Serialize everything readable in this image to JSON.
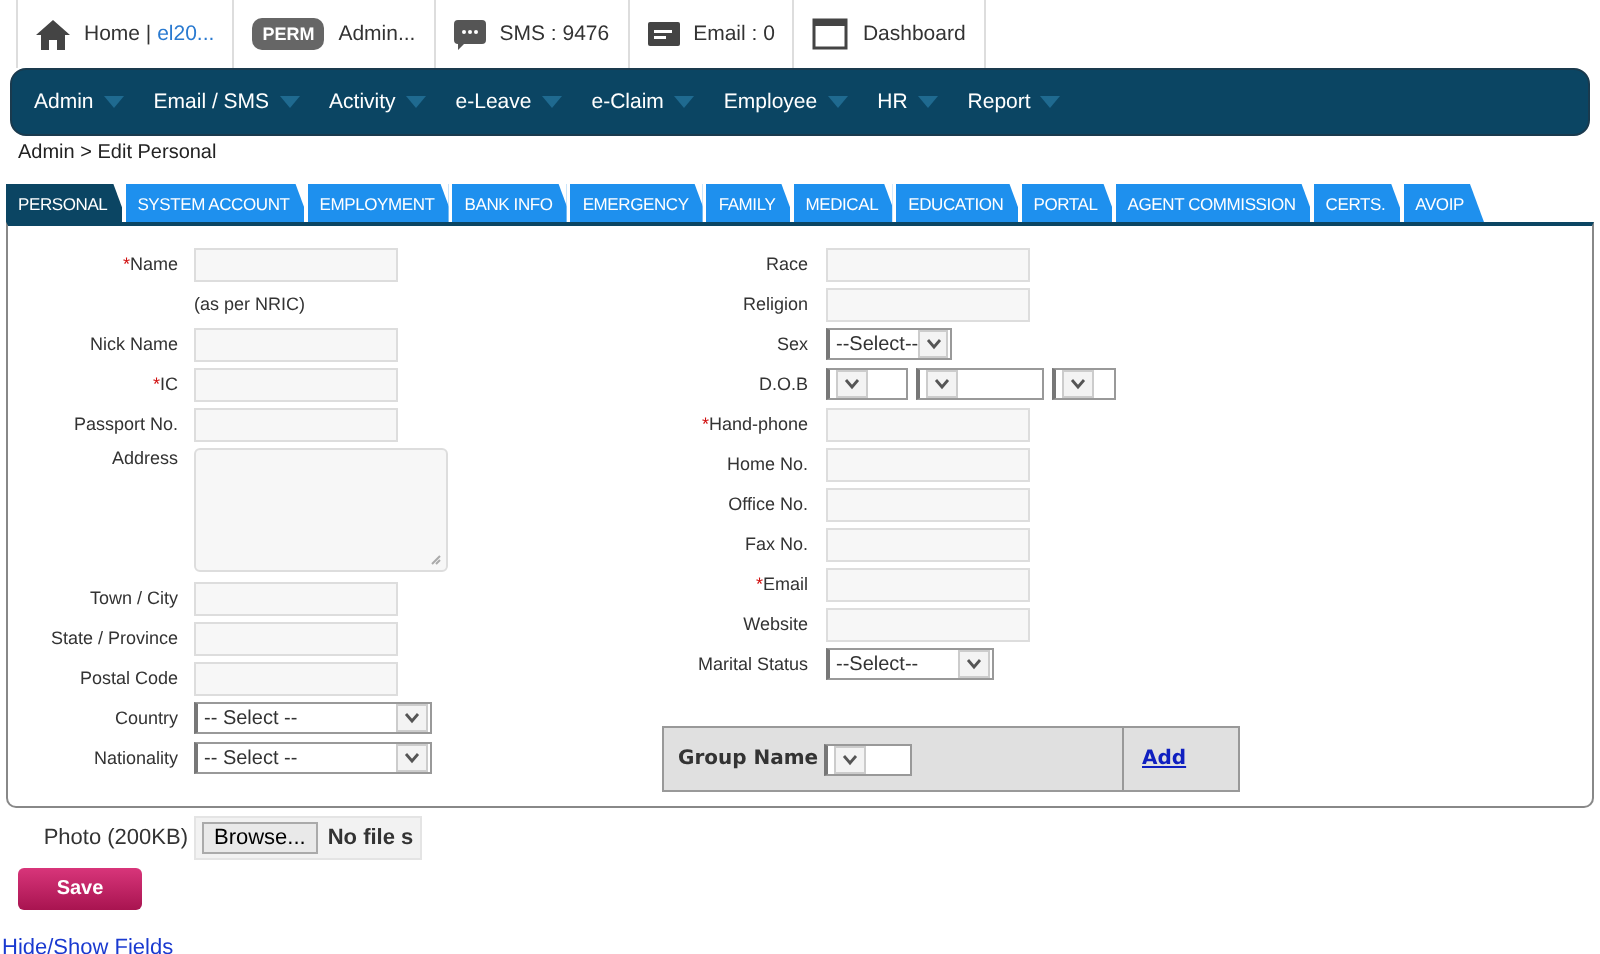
{
  "topbar": [
    {
      "kind": "home",
      "text": "Home | ",
      "link": "el20..."
    },
    {
      "kind": "perm",
      "badge": "PERM",
      "text": "Admin..."
    },
    {
      "kind": "sms",
      "text": "SMS : 9476"
    },
    {
      "kind": "email",
      "text": "Email : 0"
    },
    {
      "kind": "dashboard",
      "text": "Dashboard"
    }
  ],
  "nav": [
    "Admin",
    "Email / SMS",
    "Activity",
    "e-Leave",
    "e-Claim",
    "Employee",
    "HR",
    "Report"
  ],
  "breadcrumb": "Admin > Edit Personal",
  "tabs": [
    {
      "label": "PERSONAL",
      "selected": true
    },
    {
      "label": "SYSTEM ACCOUNT",
      "selected": false
    },
    {
      "label": "EMPLOYMENT",
      "selected": false
    },
    {
      "label": "BANK INFO",
      "selected": false
    },
    {
      "label": "EMERGENCY",
      "selected": false
    },
    {
      "label": "FAMILY",
      "selected": false
    },
    {
      "label": "MEDICAL",
      "selected": false
    },
    {
      "label": "EDUCATION",
      "selected": false
    },
    {
      "label": "PORTAL",
      "selected": false
    },
    {
      "label": "AGENT COMMISSION",
      "selected": false
    },
    {
      "label": "CERTS.",
      "selected": false
    },
    {
      "label": "AVOIP",
      "selected": false
    }
  ],
  "left_fields": [
    {
      "kind": "text",
      "label": "Name",
      "required_mark": "*"
    },
    {
      "kind": "note",
      "text": "(as per NRIC)"
    },
    {
      "kind": "text",
      "label": "Nick Name"
    },
    {
      "kind": "text",
      "label": "IC",
      "required_mark": "*"
    },
    {
      "kind": "text",
      "label": "Passport No."
    },
    {
      "kind": "textarea",
      "label": "Address"
    },
    {
      "kind": "text",
      "label": "Town / City"
    },
    {
      "kind": "text",
      "label": "State / Province"
    },
    {
      "kind": "text",
      "label": "Postal Code"
    },
    {
      "kind": "select",
      "label": "Country",
      "value": "-- Select --"
    },
    {
      "kind": "select",
      "label": "Nationality",
      "value": "-- Select --"
    }
  ],
  "right_fields": [
    {
      "kind": "text",
      "label": "Race"
    },
    {
      "kind": "text",
      "label": "Religion"
    },
    {
      "kind": "select_small",
      "label": "Sex",
      "value": "--Select--"
    },
    {
      "kind": "dob",
      "label": "D.O.B"
    },
    {
      "kind": "text",
      "label": "Hand-phone",
      "required_mark": "*"
    },
    {
      "kind": "text",
      "label": "Home No."
    },
    {
      "kind": "text",
      "label": "Office No."
    },
    {
      "kind": "text",
      "label": "Fax No."
    },
    {
      "kind": "text",
      "label": "Email",
      "required_mark": "*"
    },
    {
      "kind": "text",
      "label": "Website"
    },
    {
      "kind": "select_medium",
      "label": "Marital Status",
      "value": "--Select--"
    }
  ],
  "group": {
    "label": "Group Name",
    "link": "Add"
  },
  "photo": {
    "label": "Photo (200KB)",
    "button": "Browse...",
    "file_text": "No file s"
  },
  "save_button": "Save",
  "toggle_link": "Hide/Show Fields"
}
